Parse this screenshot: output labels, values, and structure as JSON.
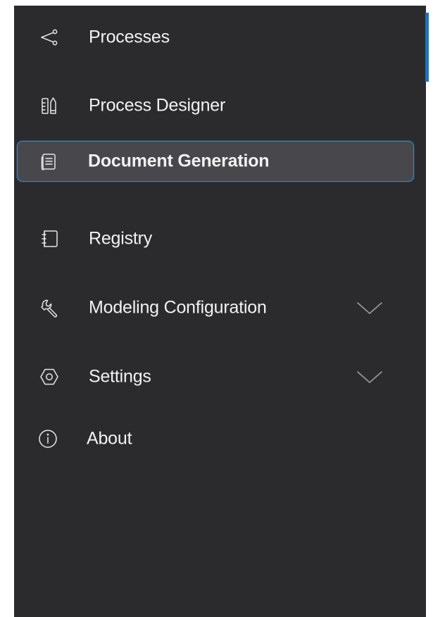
{
  "sidebar": {
    "accent_color": "#2f86e0",
    "background_color": "#2b2b2d",
    "active_item": "Document Generation",
    "items": [
      {
        "label": "Processes",
        "icon": "share-nodes-icon",
        "expandable": false
      },
      {
        "label": "Process Designer",
        "icon": "designer-tools-icon",
        "expandable": false
      },
      {
        "label": "Document Generation",
        "icon": "document-stack-icon",
        "expandable": false
      },
      {
        "label": "Registry",
        "icon": "notebook-icon",
        "expandable": false
      },
      {
        "label": "Modeling Configuration",
        "icon": "wrench-icon",
        "expandable": true
      },
      {
        "label": "Settings",
        "icon": "hex-settings-icon",
        "expandable": true
      },
      {
        "label": "About",
        "icon": "info-icon",
        "expandable": false
      }
    ]
  }
}
